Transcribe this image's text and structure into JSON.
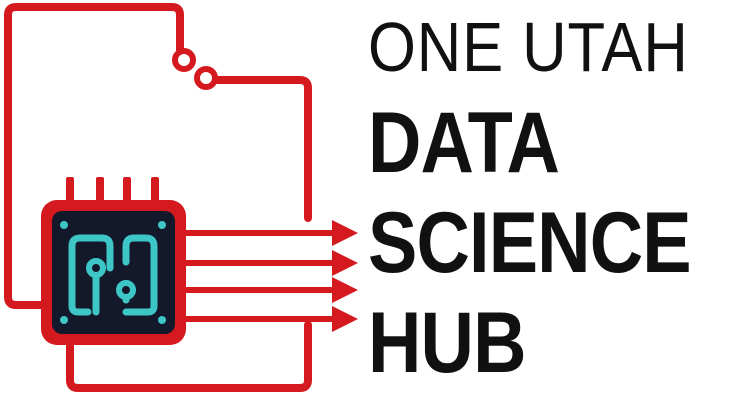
{
  "logo": {
    "colors": {
      "circuit_red": "#d41a1f",
      "chip_body": "#13182b",
      "chip_trace": "#3ec6c6",
      "text": "#111111"
    },
    "icons": [
      "circuit-trace-icon",
      "microchip-icon",
      "arrow-icon"
    ]
  },
  "wordmark": {
    "line1": "ONE UTAH",
    "line2": "DATA",
    "line3": "SCIENCE",
    "line4": "HUB"
  }
}
